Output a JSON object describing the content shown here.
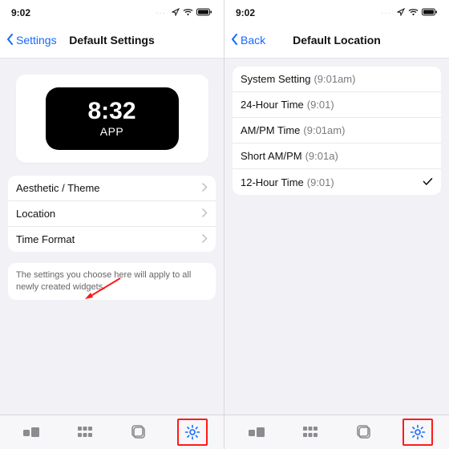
{
  "status": {
    "time": "9:02",
    "indicators": "···"
  },
  "left": {
    "back": "Settings",
    "title": "Default Settings",
    "widget": {
      "time": "8:32",
      "sub": "APP"
    },
    "menu": [
      {
        "label": "Aesthetic / Theme"
      },
      {
        "label": "Location"
      },
      {
        "label": "Time Format"
      }
    ],
    "note": "The settings you choose here will apply to all newly created widgets."
  },
  "right": {
    "back": "Back",
    "title": "Default Location",
    "options": [
      {
        "label": "System Setting",
        "example": "(9:01am)",
        "selected": false
      },
      {
        "label": "24-Hour Time",
        "example": "(9:01)",
        "selected": false
      },
      {
        "label": "AM/PM Time",
        "example": "(9:01am)",
        "selected": false
      },
      {
        "label": "Short AM/PM",
        "example": "(9:01a)",
        "selected": false
      },
      {
        "label": "12-Hour Time",
        "example": "(9:01)",
        "selected": true
      }
    ]
  }
}
